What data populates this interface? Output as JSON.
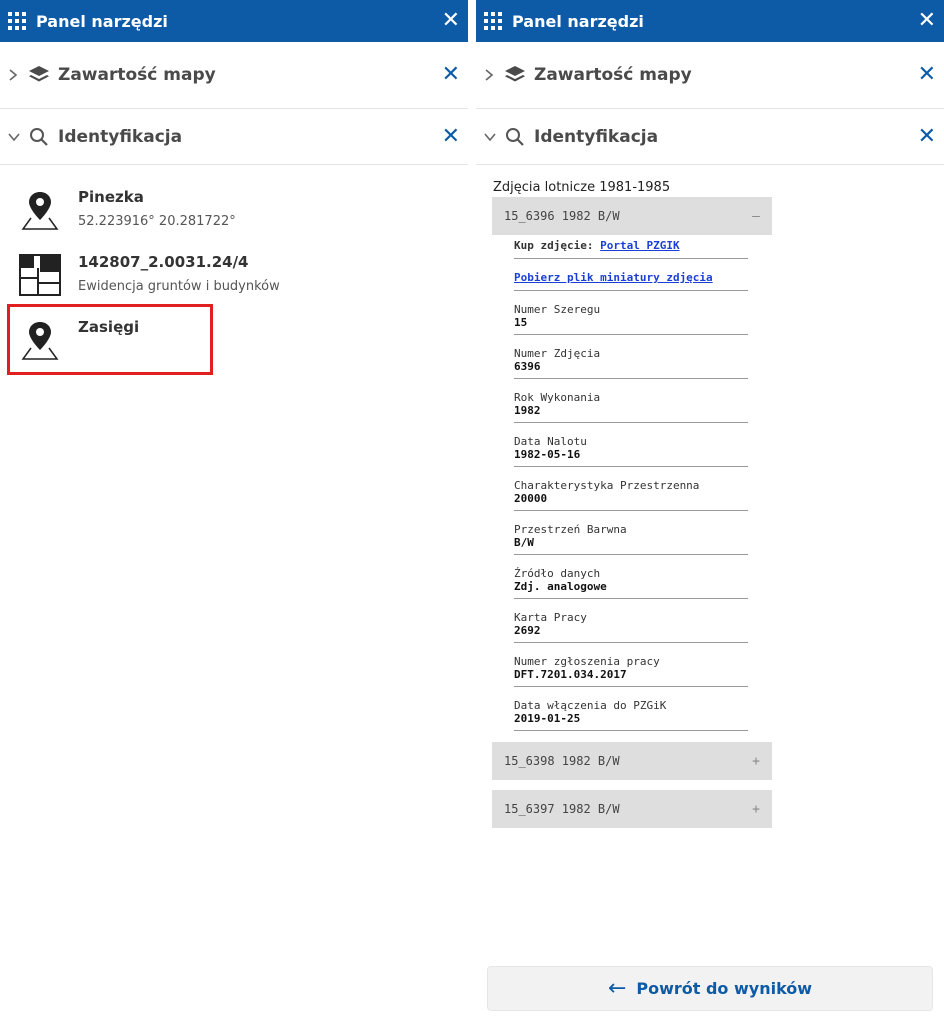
{
  "left": {
    "topbar": {
      "title": "Panel narzędzi",
      "close_icon": "close-icon"
    },
    "sections": [
      {
        "title": "Zawartość mapy",
        "chevron": "chevron-right-icon",
        "icon": "layers-icon"
      },
      {
        "title": "Identyfikacja",
        "chevron": "chevron-down-icon",
        "icon": "search-icon"
      }
    ],
    "results": [
      {
        "title": "Pinezka",
        "subtitle": "52.223916° 20.281722°",
        "icon": "map-pin-icon"
      },
      {
        "title": "142807_2.0031.24/4",
        "subtitle": "Ewidencja gruntów i budynków",
        "icon": "parcel-icon"
      },
      {
        "title": "Zasięgi",
        "subtitle": "",
        "icon": "map-pin-icon"
      }
    ],
    "highlight_color": "#e02020"
  },
  "right": {
    "topbar": {
      "title": "Panel narzędzi"
    },
    "sections": [
      {
        "title": "Zawartość mapy"
      },
      {
        "title": "Identyfikacja"
      }
    ],
    "group_title": "Zdjęcia lotnicze 1981-1985",
    "items": [
      {
        "label": "15_6396 1982 B/W",
        "toggle": "–",
        "expanded": true
      },
      {
        "label": "15_6398 1982 B/W",
        "toggle": "+",
        "expanded": false
      },
      {
        "label": "15_6397 1982 B/W",
        "toggle": "+",
        "expanded": false
      }
    ],
    "buy_label": "Kup zdjęcie:",
    "buy_link": "Portal PZGIK",
    "download_link": "Pobierz plik miniatury zdjęcia",
    "attributes": [
      {
        "label": "Numer Szeregu",
        "value": "15"
      },
      {
        "label": "Numer Zdjęcia",
        "value": "6396"
      },
      {
        "label": "Rok Wykonania",
        "value": "1982"
      },
      {
        "label": "Data Nalotu",
        "value": "1982-05-16"
      },
      {
        "label": "Charakterystyka Przestrzenna",
        "value": "20000"
      },
      {
        "label": "Przestrzeń Barwna",
        "value": "B/W"
      },
      {
        "label": "Źródło danych",
        "value": "Zdj. analogowe"
      },
      {
        "label": "Karta Pracy",
        "value": "2692"
      },
      {
        "label": "Numer zgłoszenia pracy",
        "value": "DFT.7201.034.2017"
      },
      {
        "label": "Data włączenia do PZGiK",
        "value": "2019-01-25"
      }
    ],
    "back_button": "Powrót do wyników"
  },
  "colors": {
    "brand": "#0d5aa7",
    "link": "#1a3fd8",
    "accordion_bg": "#dedede"
  }
}
